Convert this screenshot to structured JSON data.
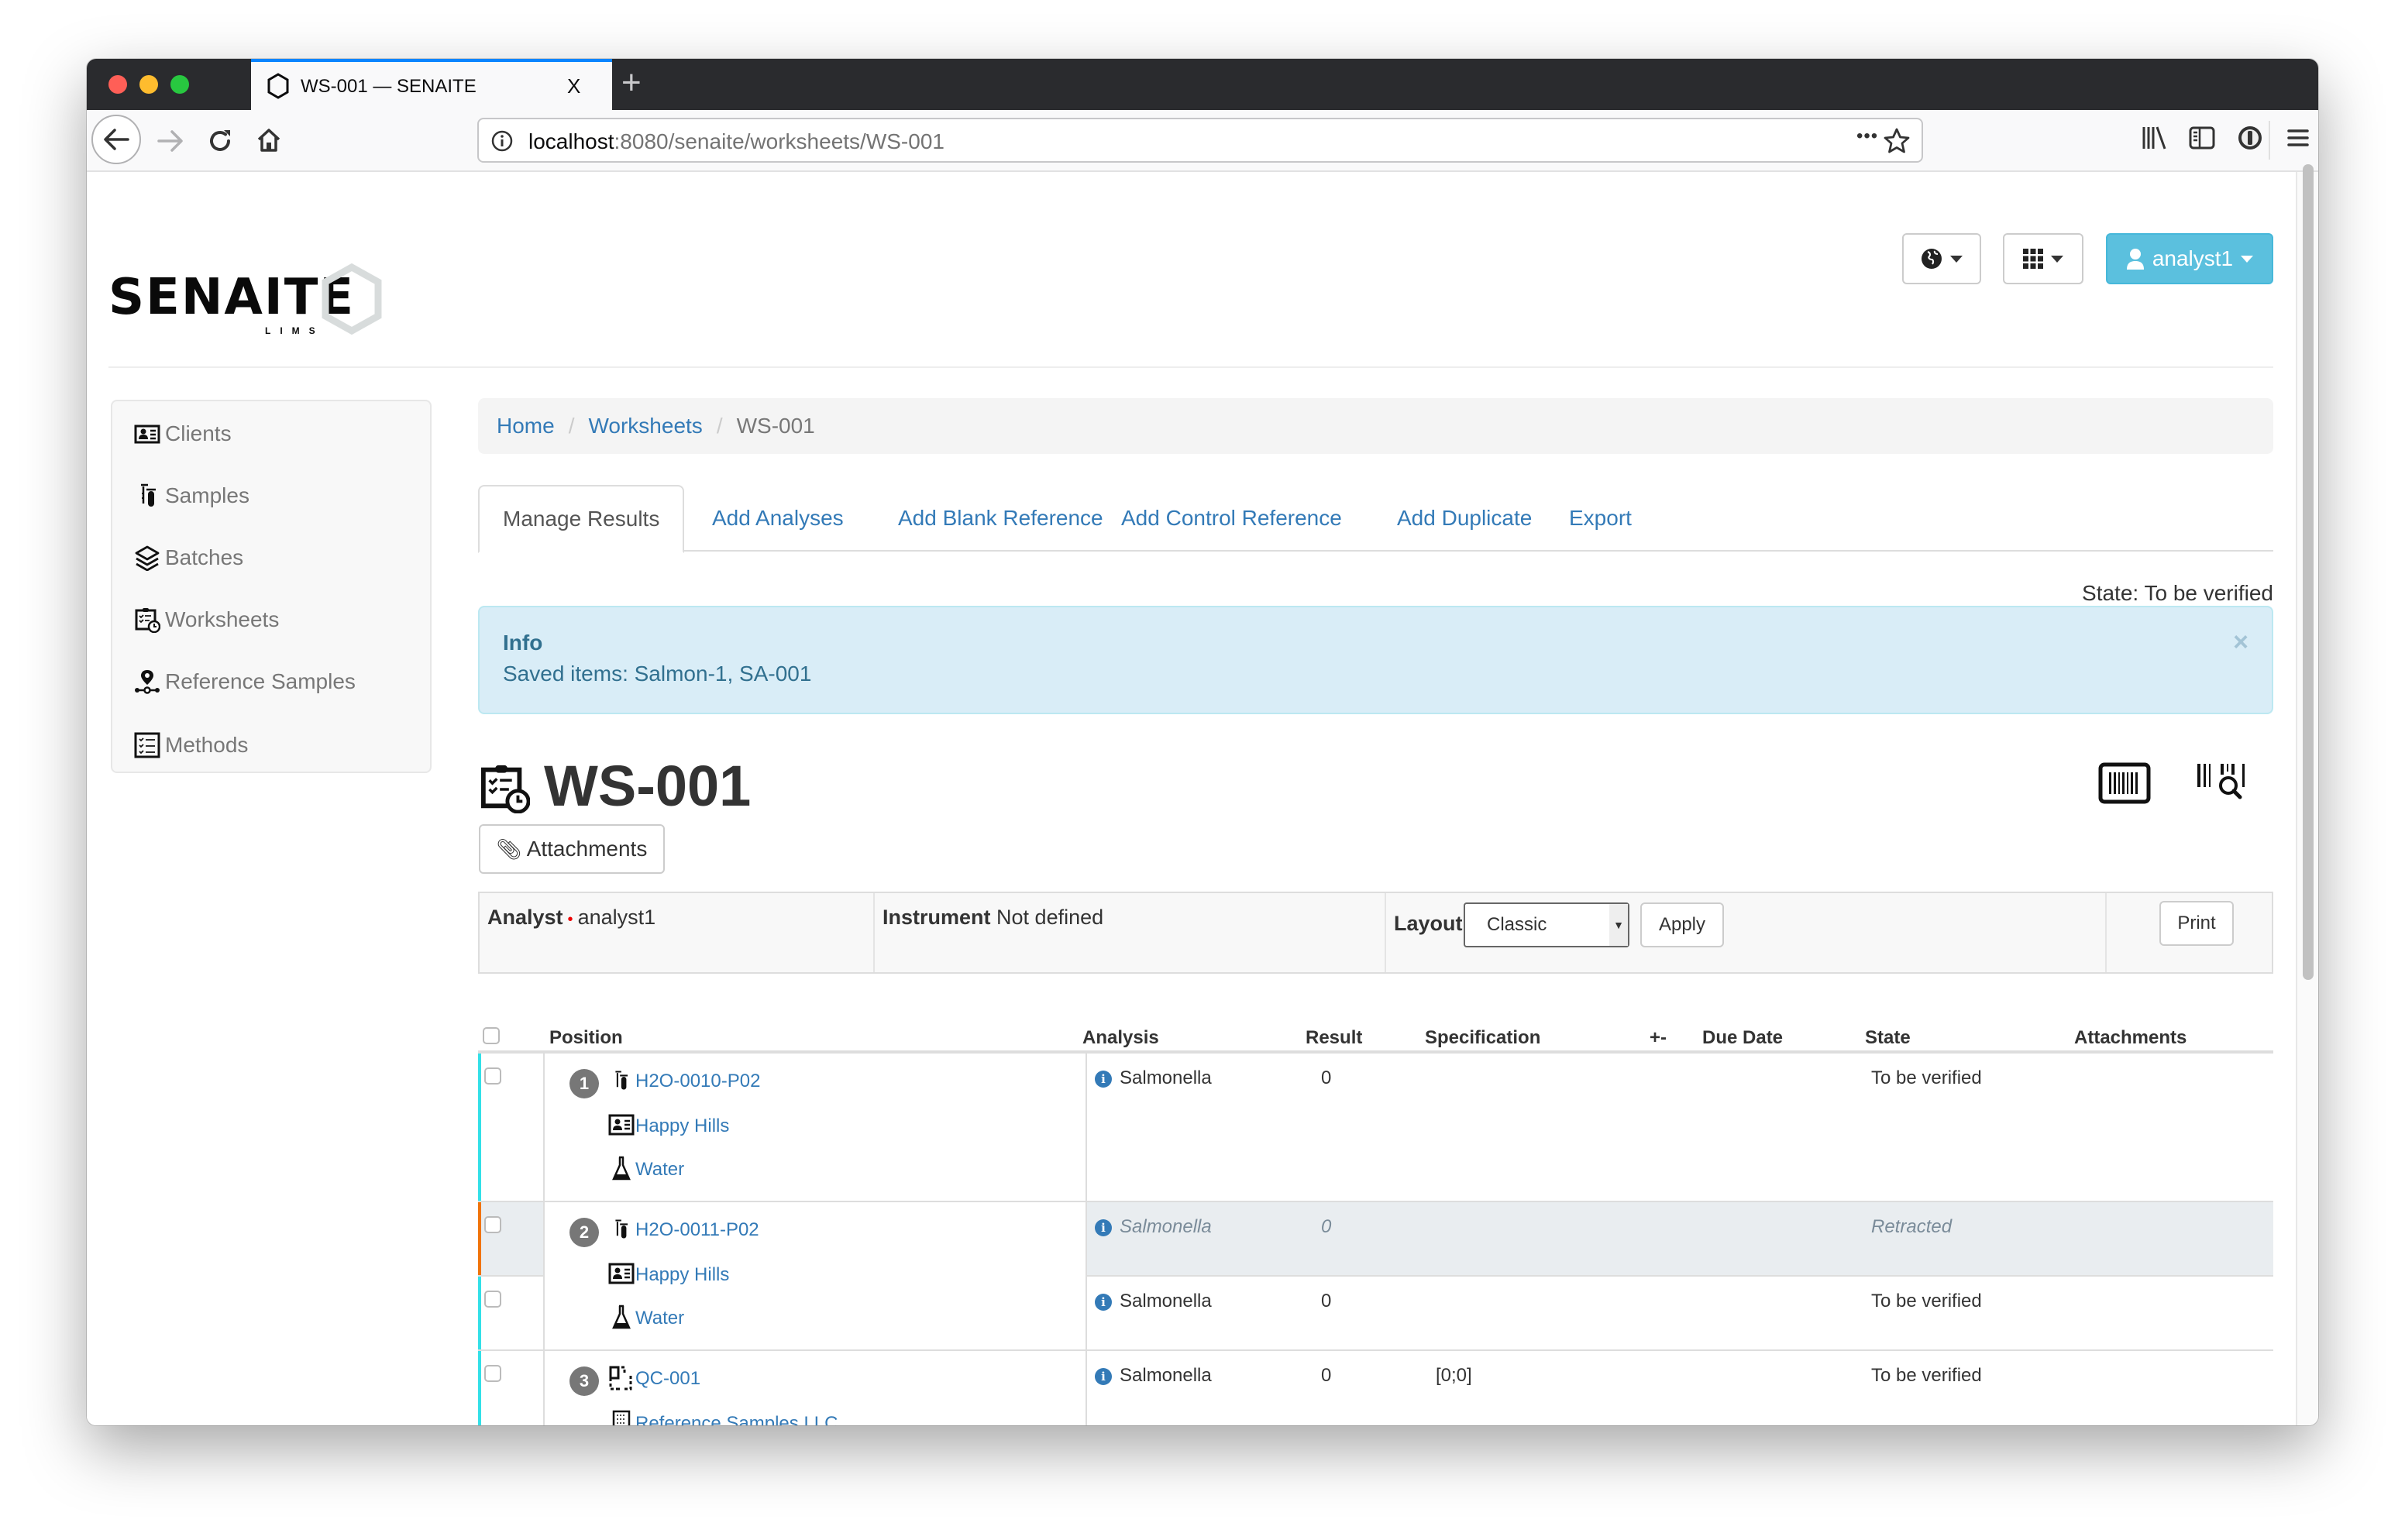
{
  "browser": {
    "tab_title": "WS-001 — SENAITE",
    "tab_close": "X",
    "new_tab": "+",
    "url_host": "localhost",
    "url_path": ":8080/senaite/worksheets/WS-001",
    "url_more": "•••"
  },
  "header": {
    "logo_text": "SENAITE",
    "logo_sub": "LIMS",
    "user_label": "analyst1"
  },
  "sidebar": {
    "items": [
      {
        "label": "Clients",
        "icon": "clients-icon"
      },
      {
        "label": "Samples",
        "icon": "samples-icon"
      },
      {
        "label": "Batches",
        "icon": "batches-icon"
      },
      {
        "label": "Worksheets",
        "icon": "worksheets-icon"
      },
      {
        "label": "Reference Samples",
        "icon": "reference-samples-icon"
      },
      {
        "label": "Methods",
        "icon": "methods-icon"
      }
    ]
  },
  "breadcrumb": {
    "items": [
      "Home",
      "Worksheets"
    ],
    "current": "WS-001",
    "separator": "/"
  },
  "tabs": [
    {
      "label": "Manage Results",
      "active": true
    },
    {
      "label": "Add Analyses"
    },
    {
      "label": "Add Blank Reference"
    },
    {
      "label": "Add Control Reference"
    },
    {
      "label": "Add Duplicate"
    },
    {
      "label": "Export"
    }
  ],
  "state_line": "State: To be verified",
  "alert": {
    "title": "Info",
    "message": "Saved items: Salmon-1, SA-001",
    "close": "×"
  },
  "page": {
    "title": "WS-001",
    "attachments_button": "Attachments"
  },
  "infobar": {
    "analyst_label": "Analyst",
    "analyst_value": "analyst1",
    "instrument_label": "Instrument",
    "instrument_value": "Not defined",
    "layout_label": "Layout",
    "layout_value": "Classic",
    "apply_button": "Apply",
    "print_button": "Print"
  },
  "table": {
    "headers": [
      "Position",
      "Analysis",
      "Result",
      "Specification",
      "+-",
      "Due Date",
      "State",
      "Attachments"
    ],
    "positions": [
      {
        "number": "1",
        "sample": "H2O-0010-P02",
        "client": "Happy Hills",
        "sample_type": "Water",
        "border_color": "#33e0e8"
      },
      {
        "number": "2",
        "sample": "H2O-0011-P02",
        "client": "Happy Hills",
        "sample_type": "Water"
      },
      {
        "number": "3",
        "sample": "QC-001",
        "client": "Reference Samples LLC."
      }
    ],
    "rows": [
      {
        "analysis": "Salmonella",
        "result": "0",
        "specification": "",
        "state": "To be verified",
        "retracted": false,
        "tag_color": "#33e0e8"
      },
      {
        "analysis": "Salmonella",
        "result": "0",
        "specification": "",
        "state": "Retracted",
        "retracted": true,
        "tag_color": "#f0730a"
      },
      {
        "analysis": "Salmonella",
        "result": "0",
        "specification": "",
        "state": "To be verified",
        "retracted": false,
        "tag_color": "#33e0e8"
      },
      {
        "analysis": "Salmonella",
        "result": "0",
        "specification": "[0;0]",
        "state": "To be verified",
        "retracted": false,
        "tag_color": "#33e0e8"
      }
    ]
  },
  "colors": {
    "link": "#337ab7",
    "user_button": "#5bc0de",
    "alert_bg": "#d9edf7",
    "alert_text": "#31708f",
    "retracted_row_bg": "#e9edf0"
  }
}
